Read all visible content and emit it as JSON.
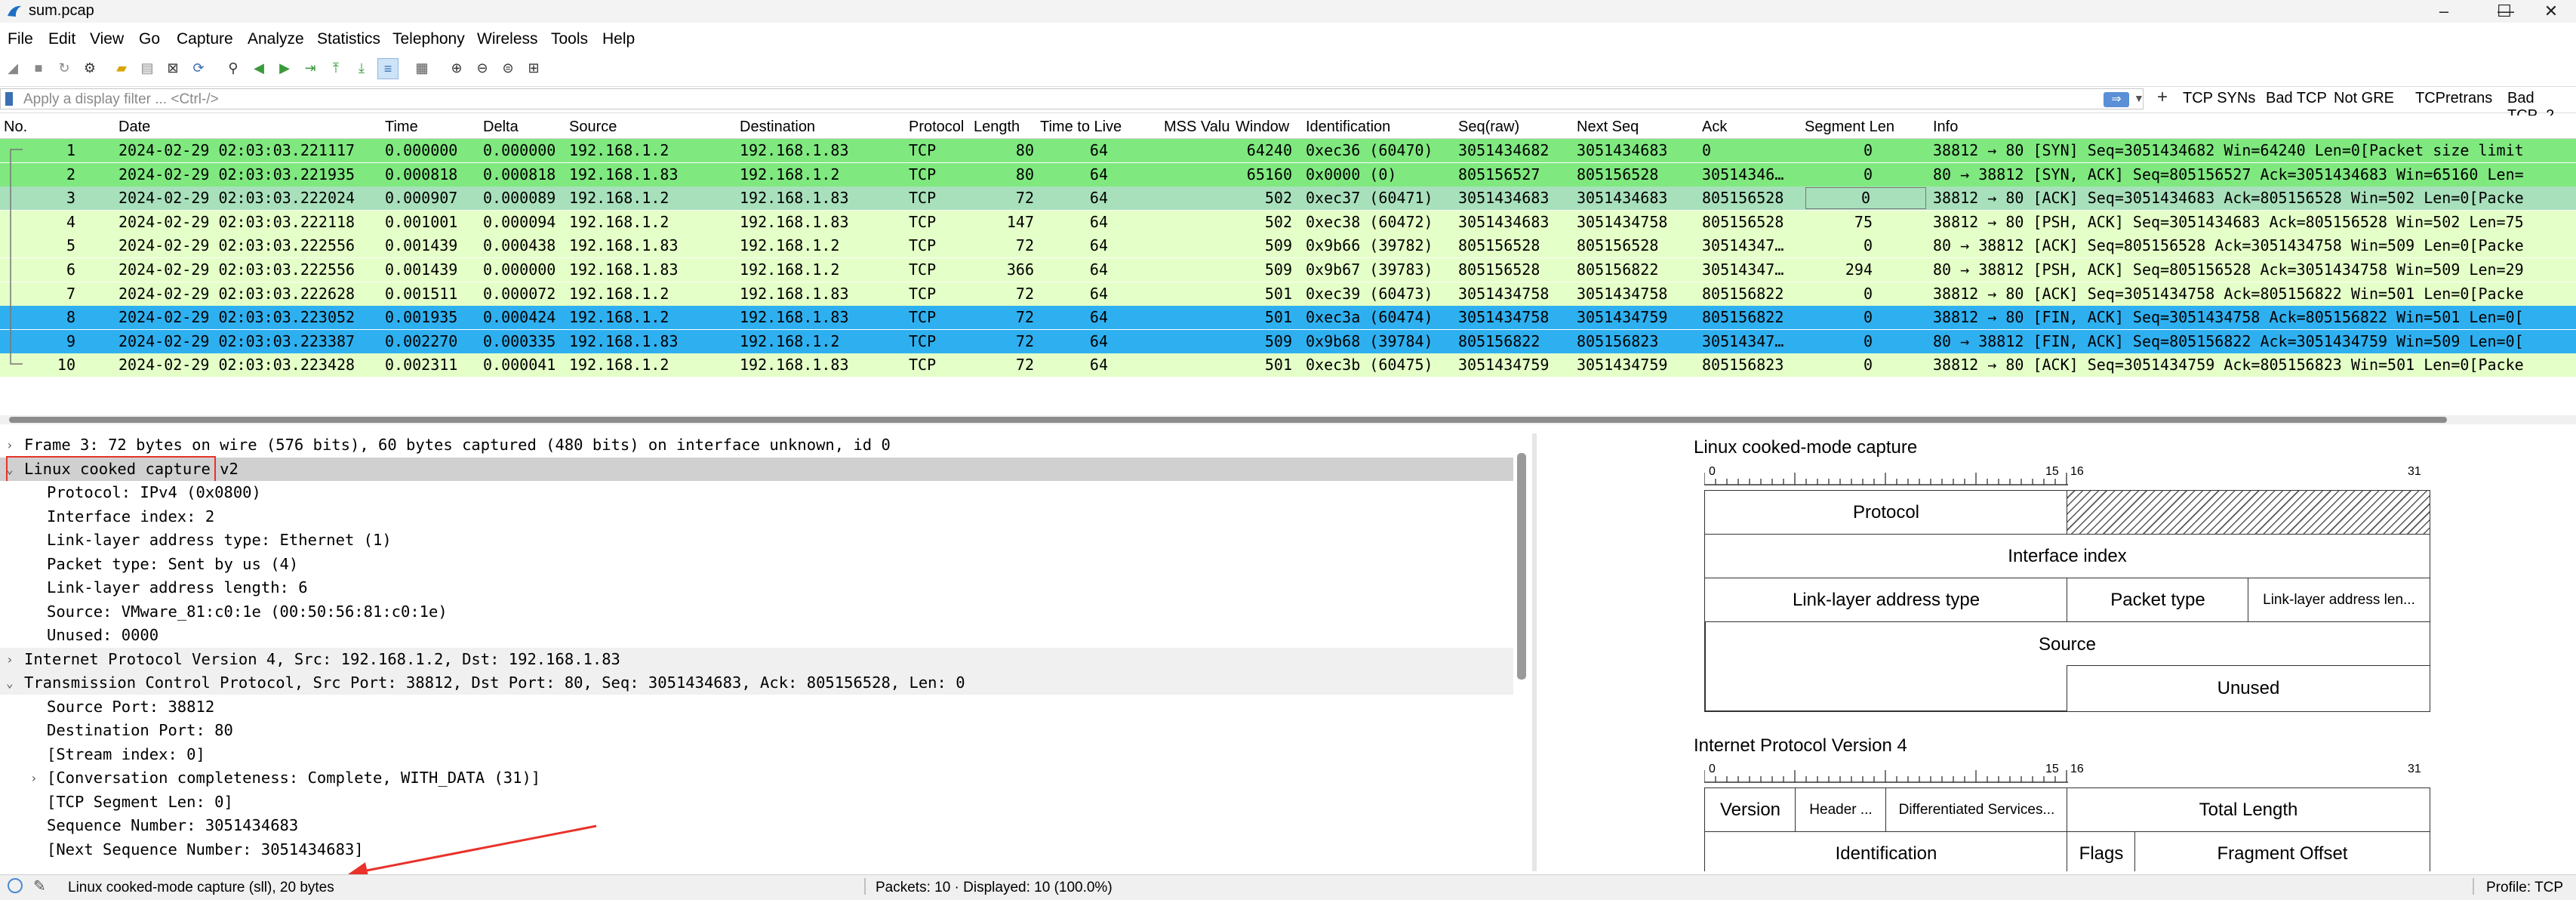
{
  "window": {
    "title": "sum.pcap"
  },
  "menu": [
    "File",
    "Edit",
    "View",
    "Go",
    "Capture",
    "Analyze",
    "Statistics",
    "Telephony",
    "Wireless",
    "Tools",
    "Help"
  ],
  "filter": {
    "placeholder": "Apply a display filter ... <Ctrl-/>",
    "buttons": [
      "TCP SYNs",
      "Bad TCP",
      "Not GRE",
      "TCPretrans",
      "Bad TCP_2"
    ]
  },
  "packet_list": {
    "columns": [
      "No.",
      "Date",
      "Time",
      "Delta",
      "Source",
      "Destination",
      "Protocol",
      "Length",
      "Time to Live",
      "MSS Valu",
      "Window",
      "Identification",
      "Seq(raw)",
      "Next Seq",
      "Ack",
      "Segment Len",
      "Info"
    ],
    "rows": [
      {
        "no": "1",
        "date": "2024-02-29 02:03:03.221117",
        "time": "0.000000",
        "delta": "0.000000",
        "src": "192.168.1.2",
        "dst": "192.168.1.83",
        "proto": "TCP",
        "len": "80",
        "ttl": "64",
        "mss": "",
        "win": "64240",
        "id": "0xec36 (60470)",
        "seq": "3051434682",
        "nseq": "3051434683",
        "ack": "0",
        "seglen": "0",
        "info": "38812 → 80 [SYN] Seq=3051434682 Win=64240 Len=0[Packet size limit",
        "color": "#7fe87f"
      },
      {
        "no": "2",
        "date": "2024-02-29 02:03:03.221935",
        "time": "0.000818",
        "delta": "0.000818",
        "src": "192.168.1.83",
        "dst": "192.168.1.2",
        "proto": "TCP",
        "len": "80",
        "ttl": "64",
        "mss": "",
        "win": "65160",
        "id": "0x0000 (0)",
        "seq": "805156527",
        "nseq": "805156528",
        "ack": "30514346…",
        "seglen": "0",
        "info": "80 → 38812 [SYN, ACK] Seq=805156527 Ack=3051434683 Win=65160 Len=",
        "color": "#7fe87f"
      },
      {
        "no": "3",
        "date": "2024-02-29 02:03:03.222024",
        "time": "0.000907",
        "delta": "0.000089",
        "src": "192.168.1.2",
        "dst": "192.168.1.83",
        "proto": "TCP",
        "len": "72",
        "ttl": "64",
        "mss": "",
        "win": "502",
        "id": "0xec37 (60471)",
        "seq": "3051434683",
        "nseq": "3051434683",
        "ack": "805156528",
        "seglen": "0",
        "info": "38812 → 80 [ACK] Seq=3051434683 Ack=805156528 Win=502 Len=0[Packe",
        "color": "#a8e0bb"
      },
      {
        "no": "4",
        "date": "2024-02-29 02:03:03.222118",
        "time": "0.001001",
        "delta": "0.000094",
        "src": "192.168.1.2",
        "dst": "192.168.1.83",
        "proto": "TCP",
        "len": "147",
        "ttl": "64",
        "mss": "",
        "win": "502",
        "id": "0xec38 (60472)",
        "seq": "3051434683",
        "nseq": "3051434758",
        "ack": "805156528",
        "seglen": "75",
        "info": "38812 → 80 [PSH, ACK] Seq=3051434683 Ack=805156528 Win=502 Len=75",
        "color": "#e4ffc7"
      },
      {
        "no": "5",
        "date": "2024-02-29 02:03:03.222556",
        "time": "0.001439",
        "delta": "0.000438",
        "src": "192.168.1.83",
        "dst": "192.168.1.2",
        "proto": "TCP",
        "len": "72",
        "ttl": "64",
        "mss": "",
        "win": "509",
        "id": "0x9b66 (39782)",
        "seq": "805156528",
        "nseq": "805156528",
        "ack": "30514347…",
        "seglen": "0",
        "info": "80 → 38812 [ACK] Seq=805156528 Ack=3051434758 Win=509 Len=0[Packe",
        "color": "#e4ffc7"
      },
      {
        "no": "6",
        "date": "2024-02-29 02:03:03.222556",
        "time": "0.001439",
        "delta": "0.000000",
        "src": "192.168.1.83",
        "dst": "192.168.1.2",
        "proto": "TCP",
        "len": "366",
        "ttl": "64",
        "mss": "",
        "win": "509",
        "id": "0x9b67 (39783)",
        "seq": "805156528",
        "nseq": "805156822",
        "ack": "30514347…",
        "seglen": "294",
        "info": "80 → 38812 [PSH, ACK] Seq=805156528 Ack=3051434758 Win=509 Len=29",
        "color": "#e4ffc7"
      },
      {
        "no": "7",
        "date": "2024-02-29 02:03:03.222628",
        "time": "0.001511",
        "delta": "0.000072",
        "src": "192.168.1.2",
        "dst": "192.168.1.83",
        "proto": "TCP",
        "len": "72",
        "ttl": "64",
        "mss": "",
        "win": "501",
        "id": "0xec39 (60473)",
        "seq": "3051434758",
        "nseq": "3051434758",
        "ack": "805156822",
        "seglen": "0",
        "info": "38812 → 80 [ACK] Seq=3051434758 Ack=805156822 Win=501 Len=0[Packe",
        "color": "#e4ffc7"
      },
      {
        "no": "8",
        "date": "2024-02-29 02:03:03.223052",
        "time": "0.001935",
        "delta": "0.000424",
        "src": "192.168.1.2",
        "dst": "192.168.1.83",
        "proto": "TCP",
        "len": "72",
        "ttl": "64",
        "mss": "",
        "win": "501",
        "id": "0xec3a (60474)",
        "seq": "3051434758",
        "nseq": "3051434759",
        "ack": "805156822",
        "seglen": "0",
        "info": "38812 → 80 [FIN, ACK] Seq=3051434758 Ack=805156822 Win=501 Len=0[",
        "color": "#2eb0f0"
      },
      {
        "no": "9",
        "date": "2024-02-29 02:03:03.223387",
        "time": "0.002270",
        "delta": "0.000335",
        "src": "192.168.1.83",
        "dst": "192.168.1.2",
        "proto": "TCP",
        "len": "72",
        "ttl": "64",
        "mss": "",
        "win": "509",
        "id": "0x9b68 (39784)",
        "seq": "805156822",
        "nseq": "805156823",
        "ack": "30514347…",
        "seglen": "0",
        "info": "80 → 38812 [FIN, ACK] Seq=805156822 Ack=3051434759 Win=509 Len=0[",
        "color": "#2eb0f0"
      },
      {
        "no": "10",
        "date": "2024-02-29 02:03:03.223428",
        "time": "0.002311",
        "delta": "0.000041",
        "src": "192.168.1.2",
        "dst": "192.168.1.83",
        "proto": "TCP",
        "len": "72",
        "ttl": "64",
        "mss": "",
        "win": "501",
        "id": "0xec3b (60475)",
        "seq": "3051434759",
        "nseq": "3051434759",
        "ack": "805156823",
        "seglen": "0",
        "info": "38812 → 80 [ACK] Seq=3051434759 Ack=805156823 Win=501 Len=0[Packe",
        "color": "#e4ffc7"
      }
    ]
  },
  "details": [
    {
      "text": "Frame 3: 72 bytes on wire (576 bits), 60 bytes captured (480 bits) on interface unknown, id 0",
      "level": 0,
      "twisty": "›",
      "bg": "#ffffff"
    },
    {
      "text": "Linux cooked capture v2",
      "level": 0,
      "twisty": "⌄",
      "bg": "#d0d0d0",
      "highlight": true
    },
    {
      "text": "Protocol: IPv4 (0x0800)",
      "level": 1,
      "twisty": "",
      "bg": "#ffffff"
    },
    {
      "text": "Interface index: 2",
      "level": 1,
      "twisty": "",
      "bg": "#ffffff"
    },
    {
      "text": "Link-layer address type: Ethernet (1)",
      "level": 1,
      "twisty": "",
      "bg": "#ffffff"
    },
    {
      "text": "Packet type: Sent by us (4)",
      "level": 1,
      "twisty": "",
      "bg": "#ffffff"
    },
    {
      "text": "Link-layer address length: 6",
      "level": 1,
      "twisty": "",
      "bg": "#ffffff"
    },
    {
      "text": "Source: VMware_81:c0:1e (00:50:56:81:c0:1e)",
      "level": 1,
      "twisty": "",
      "bg": "#ffffff"
    },
    {
      "text": "Unused: 0000",
      "level": 1,
      "twisty": "",
      "bg": "#ffffff"
    },
    {
      "text": "Internet Protocol Version 4, Src: 192.168.1.2, Dst: 192.168.1.83",
      "level": 0,
      "twisty": "›",
      "bg": "#f0f0f0"
    },
    {
      "text": "Transmission Control Protocol, Src Port: 38812, Dst Port: 80, Seq: 3051434683, Ack: 805156528, Len: 0",
      "level": 0,
      "twisty": "⌄",
      "bg": "#f0f0f0"
    },
    {
      "text": "Source Port: 38812",
      "level": 1,
      "twisty": "",
      "bg": "#ffffff"
    },
    {
      "text": "Destination Port: 80",
      "level": 1,
      "twisty": "",
      "bg": "#ffffff"
    },
    {
      "text": "[Stream index: 0]",
      "level": 1,
      "twisty": "",
      "bg": "#ffffff"
    },
    {
      "text": "[Conversation completeness: Complete, WITH_DATA (31)]",
      "level": 1,
      "twisty": "›",
      "bg": "#ffffff"
    },
    {
      "text": "[TCP Segment Len: 0]",
      "level": 1,
      "twisty": "",
      "bg": "#ffffff"
    },
    {
      "text": "Sequence Number: 3051434683",
      "level": 1,
      "twisty": "",
      "bg": "#ffffff"
    },
    {
      "text": "[Next Sequence Number: 3051434683]",
      "level": 1,
      "twisty": "",
      "bg": "#ffffff"
    }
  ],
  "diagram": {
    "sll_title": "Linux cooked-mode capture",
    "ipv4_title": "Internet Protocol Version 4",
    "ticks": {
      "b0": "0",
      "b15": "15",
      "b16": "16",
      "b31": "31"
    },
    "sll_fields": {
      "protocol": "Protocol",
      "interface_index": "Interface index",
      "ll_addr_type": "Link-layer address type",
      "packet_type": "Packet type",
      "ll_addr_len": "Link-layer address len...",
      "source": "Source",
      "unused": "Unused"
    },
    "ipv4_fields": {
      "version": "Version",
      "header": "Header ...",
      "dsf": "Differentiated Services...",
      "total_length": "Total Length",
      "identification": "Identification",
      "flags": "Flags",
      "fragment_offset": "Fragment Offset"
    }
  },
  "status": {
    "left": "Linux cooked-mode capture (sll), 20 bytes",
    "packets": "Packets: 10 · Displayed: 10 (100.0%)",
    "profile": "Profile: TCP"
  },
  "colors": {
    "arrow": "#e8322a",
    "highlight_box": "#e8322a",
    "selected_row": "#a8e0bb"
  }
}
